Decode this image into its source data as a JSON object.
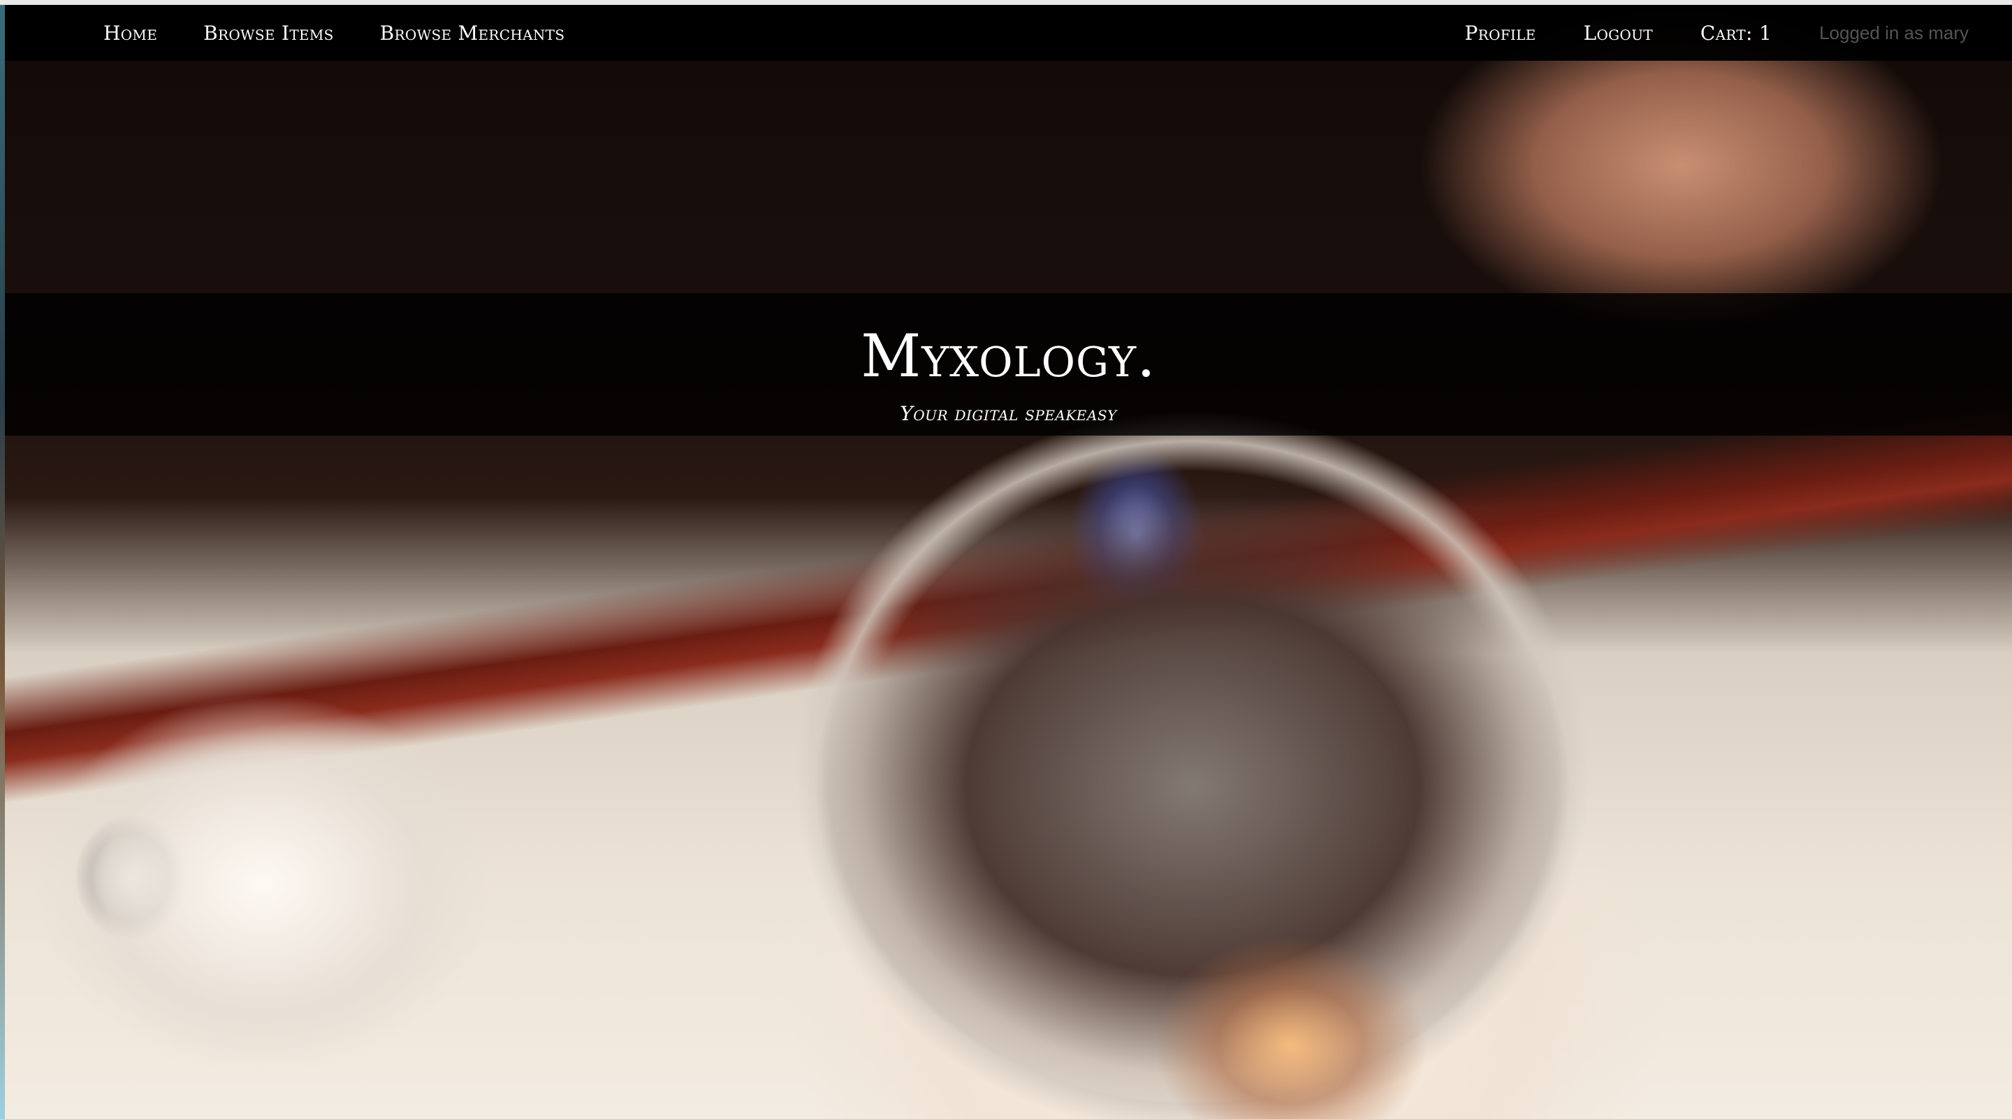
{
  "nav": {
    "left": [
      {
        "label": "Home"
      },
      {
        "label": "Browse Items"
      },
      {
        "label": "Browse Merchants"
      }
    ],
    "right": [
      {
        "label": "Profile"
      },
      {
        "label": "Logout"
      },
      {
        "label": "Cart: 1"
      }
    ],
    "status": "Logged in as mary"
  },
  "hero": {
    "title": "Myxology.",
    "tagline": "Your digital speakeasy",
    "image_icon": "hero-photo"
  },
  "colors": {
    "nav_background": "#000000",
    "nav_text": "#ffffff",
    "status_text": "#545454",
    "title_text": "#ffffff"
  }
}
